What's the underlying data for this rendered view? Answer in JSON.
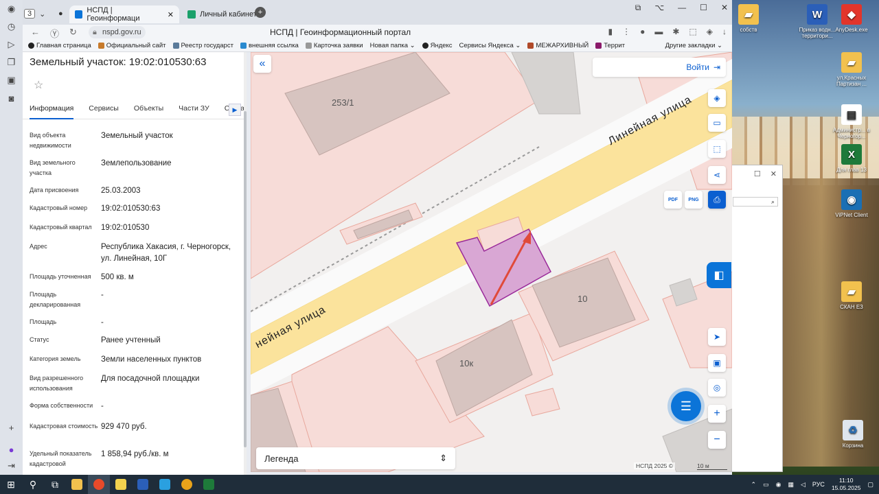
{
  "desktop": {
    "icons": [
      {
        "label": "собств",
        "color": "#f2c14e",
        "glyph": "▰"
      },
      {
        "label": "Приказ водн... территори...",
        "color": "#2b5fb8",
        "glyph": "W"
      },
      {
        "label": "AnyDesk.exe",
        "color": "#e2352b",
        "glyph": "◆"
      },
      {
        "label": "ул.Красных Партизан ...",
        "color": "#f2c14e",
        "glyph": "▰"
      },
      {
        "label": "Администр... в Черногор...",
        "color": "#ffffff",
        "glyph": "▤"
      },
      {
        "label": "Для глав 13",
        "color": "#1e7a3a",
        "glyph": "X"
      },
      {
        "label": "ViPNet Client",
        "color": "#1a6fb4",
        "glyph": "◉"
      },
      {
        "label": "СКАН ЕЗ",
        "color": "#f2c14e",
        "glyph": "▰"
      },
      {
        "label": "Корзина",
        "color": "#dfe6ee",
        "glyph": "♻"
      }
    ]
  },
  "browser": {
    "tab_count": "3",
    "tabs": [
      {
        "label": "НСПД | Геоинформаци",
        "close": "✕"
      },
      {
        "label": "Личный кабинет"
      }
    ],
    "new_tab": "+",
    "url": "nspd.gov.ru",
    "page_title": "НСПД | Геоинформационный портал",
    "bookmarks": [
      {
        "label": "Главная страница",
        "color": "#222"
      },
      {
        "label": "Официальный сайт",
        "color": "#c77a2a"
      },
      {
        "label": "Реестр государст",
        "color": "#5a7a9a"
      },
      {
        "label": "внешняя ссылка",
        "color": "#2a8ad0"
      },
      {
        "label": "Карточка заявки",
        "color": "#999"
      },
      {
        "label": "Новая папка ⌄",
        "color": ""
      },
      {
        "label": "Яндекс",
        "color": "#222"
      },
      {
        "label": "Сервисы Яндекса ⌄",
        "color": ""
      },
      {
        "label": "МЕЖАРХИВНЫЙ",
        "color": "#b04a2a"
      },
      {
        "label": "Террит",
        "color": "#8a1a6a"
      }
    ],
    "other_bookmarks": "Другие закладки ⌄"
  },
  "parcel": {
    "title": "Земельный участок: 19:02:010530:63",
    "tabs": [
      "Информация",
      "Сервисы",
      "Объекты",
      "Части ЗУ",
      "Соста"
    ],
    "attributes": [
      {
        "k": "Вид объекта недвижимости",
        "v": "Земельный участок"
      },
      {
        "k": "Вид земельного участка",
        "v": "Землепользование"
      },
      {
        "k": "Дата присвоения",
        "v": "25.03.2003"
      },
      {
        "k": "Кадастровый номер",
        "v": "19:02:010530:63"
      },
      {
        "k": "Кадастровый квартал",
        "v": "19:02:010530"
      },
      {
        "k": "Адрес",
        "v": "Республика Хакасия, г. Черногорск, ул. Линейная, 10Г"
      },
      {
        "k": "Площадь уточненная",
        "v": "500 кв. м"
      },
      {
        "k": "Площадь декларированная",
        "v": "-"
      },
      {
        "k": "Площадь",
        "v": "-"
      },
      {
        "k": "Статус",
        "v": "Ранее учтенный"
      },
      {
        "k": "Категория земель",
        "v": "Земли населенных пунктов"
      },
      {
        "k": "Вид разрешенного использования",
        "v": "Для посадочной площадки"
      },
      {
        "k": "Форма собственности",
        "v": "-"
      },
      {
        "k": "Кадастровая стоимость",
        "v": "929 470 руб."
      },
      {
        "k": "Удельный показатель кадастровой",
        "v": "1 858,94 руб./кв. м"
      }
    ]
  },
  "map": {
    "login_label": "Войти",
    "legend_label": "Легенда",
    "street_name": "Линейная улица",
    "street_name_2": "нейная улица",
    "labels": [
      "253/1",
      "10",
      "10к"
    ],
    "credit": "НСПД 2025 ©",
    "scale": "10 м",
    "tools": [
      "PDF",
      "PNG"
    ],
    "parcel_color": "#d9a7d4",
    "accent": "#0b5fd0"
  },
  "taskbar": {
    "lang": "РУС",
    "time": "11:10",
    "date": "15.05.2025"
  }
}
